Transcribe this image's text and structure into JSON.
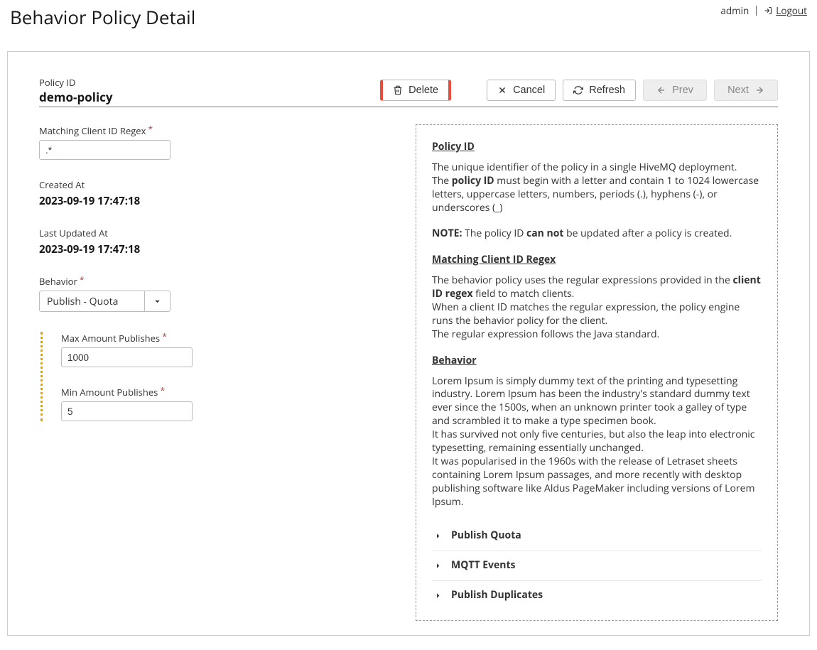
{
  "page_title": "Behavior Policy Detail",
  "user": {
    "name": "admin",
    "logout_label": "Logout"
  },
  "header": {
    "policy_id_label": "Policy ID",
    "policy_id_value": "demo-policy",
    "delete_label": "Delete",
    "cancel_label": "Cancel",
    "refresh_label": "Refresh",
    "prev_label": "Prev",
    "next_label": "Next"
  },
  "form": {
    "regex_label": "Matching Client ID Regex",
    "regex_value": ".*",
    "created_label": "Created At",
    "created_value": "2023-09-19 17:47:18",
    "updated_label": "Last Updated At",
    "updated_value": "2023-09-19 17:47:18",
    "behavior_label": "Behavior",
    "behavior_value": "Publish - Quota",
    "max_pub_label": "Max Amount Publishes",
    "max_pub_value": "1000",
    "min_pub_label": "Min Amount Publishes",
    "min_pub_value": "5"
  },
  "help": {
    "h1": "Policy ID",
    "p1": "The unique identifier of the policy in a single HiveMQ deployment.",
    "p2a": "The ",
    "p2b": "policy ID",
    "p2c": " must begin with a letter and contain 1 to 1024 lowercase letters, uppercase letters, numbers, periods (.), hyphens (-), or underscores (_)",
    "note_label": "NOTE:",
    "note_a": " The policy ID ",
    "note_b": "can not",
    "note_c": " be updated after a policy is created.",
    "h2": "Matching Client ID Regex",
    "p3a": "The behavior policy uses the regular expressions provided in the ",
    "p3b": "client ID regex",
    "p3c": " field to match clients.",
    "p4": "When a client ID matches the regular expression, the policy engine runs the behavior policy for the client.",
    "p5": "The regular expression follows the Java standard.",
    "h3": "Behavior",
    "p6": "Lorem Ipsum is simply dummy text of the printing and typesetting industry. Lorem Ipsum has been the industry's standard dummy text ever since the 1500s, when an unknown printer took a galley of type and scrambled it to make a type specimen book.",
    "p7": "It has survived not only five centuries, but also the leap into electronic typesetting, remaining essentially unchanged.",
    "p8": "It was popularised in the 1960s with the release of Letraset sheets containing Lorem Ipsum passages, and more recently with desktop publishing software like Aldus PageMaker including versions of Lorem Ipsum.",
    "links": {
      "l1": "Publish Quota",
      "l2": "MQTT Events",
      "l3": "Publish Duplicates"
    }
  }
}
